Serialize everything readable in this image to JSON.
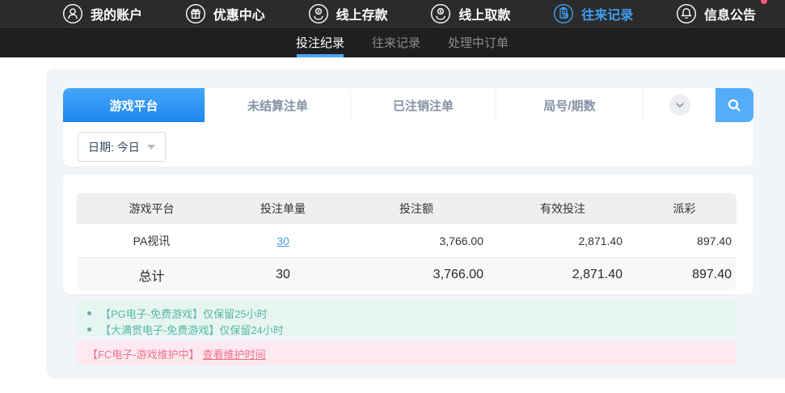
{
  "topnav": {
    "items": [
      {
        "label": "我的账户",
        "icon": "user-icon",
        "active": false
      },
      {
        "label": "优惠中心",
        "icon": "gift-icon",
        "active": false
      },
      {
        "label": "线上存款",
        "icon": "deposit-coin-icon",
        "active": false
      },
      {
        "label": "线上取款",
        "icon": "withdraw-coin-icon",
        "active": false
      },
      {
        "label": "往来记录",
        "icon": "records-clipboard-icon",
        "active": true
      },
      {
        "label": "信息公告",
        "icon": "bell-icon",
        "active": false,
        "badge": true
      }
    ]
  },
  "subnav": {
    "tabs": [
      {
        "label": "投注纪录",
        "active": true
      },
      {
        "label": "往来记录",
        "active": false
      },
      {
        "label": "处理中订单",
        "active": false
      }
    ]
  },
  "filters": {
    "tabs": [
      {
        "label": "游戏平台",
        "active": true
      },
      {
        "label": "未结算注单",
        "active": false
      },
      {
        "label": "已注销注单",
        "active": false
      },
      {
        "label": "局号/期数",
        "active": false
      }
    ],
    "dropdown_icon": "chevron-down-icon",
    "search_icon": "search-icon",
    "date_label": "日期: 今日"
  },
  "table": {
    "headers": [
      "游戏平台",
      "投注单量",
      "投注额",
      "有效投注",
      "派彩"
    ],
    "rows": [
      {
        "platform": "PA视讯",
        "count": "30",
        "amount": "3,766.00",
        "valid": "2,871.40",
        "payout": "897.40"
      }
    ],
    "total": {
      "platform": "总计",
      "count": "30",
      "amount": "3,766.00",
      "valid": "2,871.40",
      "payout": "897.40"
    }
  },
  "notes": {
    "items": [
      "【PG电子-免费游戏】仅保留25小时",
      "【大满贯电子-免费游戏】仅保留24小时"
    ],
    "maintenance_prefix": "【FC电子-游戏维护中】",
    "maintenance_link": "查看维护时间"
  },
  "colors": {
    "accent_blue": "#3f9ef5",
    "tab_gradient_top": "#45a5f8",
    "tab_gradient_bottom": "#1e88ef",
    "underline_blue": "#4ba8f5",
    "search_button": "#55acf8",
    "card_background": "#f1f5fa",
    "table_header_bg": "#efeff0",
    "total_row_bg": "#f7f8fa",
    "mint_bg": "#e7f5f1",
    "mint_text": "#57b6a6",
    "pink_bg": "#fde9ee",
    "pink_text": "#ef6f95",
    "badge_dot": "#f25681",
    "topbar_bg": "#2b2b2b",
    "subnav_bg": "#1f1f21"
  }
}
